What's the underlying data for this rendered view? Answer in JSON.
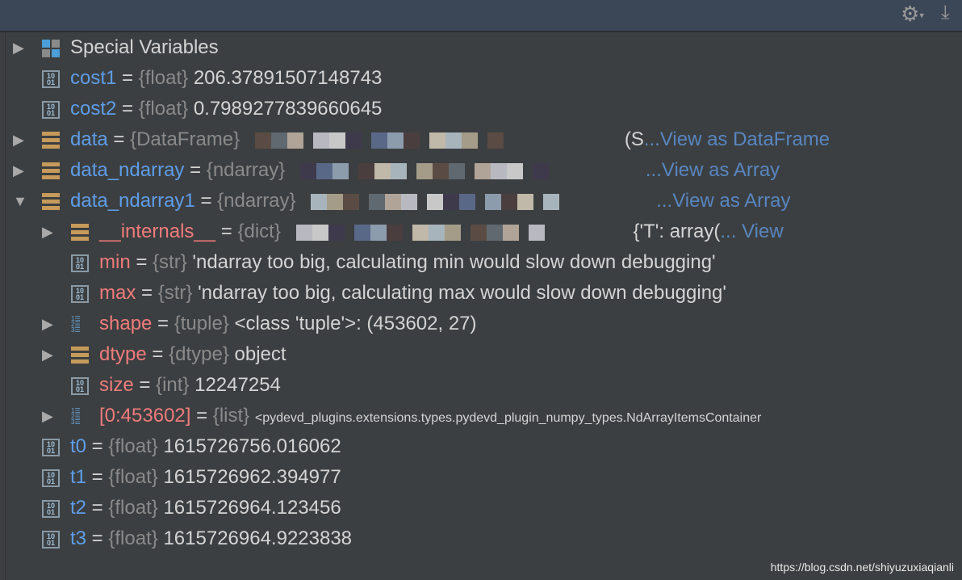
{
  "toolbar": {
    "settings_icon": "gear-icon",
    "download_icon": "download-icon"
  },
  "rows": [
    {
      "indent": 0,
      "expand": "collapsed",
      "icon": "special",
      "name": "Special Variables",
      "name_color": "plain"
    },
    {
      "indent": 0,
      "expand": "none",
      "icon": "num",
      "name": "cost1",
      "type": "{float}",
      "value": "206.37891507148743"
    },
    {
      "indent": 0,
      "expand": "none",
      "icon": "num",
      "name": "cost2",
      "type": "{float}",
      "value": "0.7989277839660645"
    },
    {
      "indent": 0,
      "expand": "collapsed",
      "icon": "stack",
      "name": "data",
      "type": "{DataFrame}",
      "value": "(S",
      "link": "...View as DataFrame"
    },
    {
      "indent": 0,
      "expand": "collapsed",
      "icon": "stack",
      "name": "data_ndarray",
      "type": "{ndarray}",
      "value": "",
      "link": "...View as Array"
    },
    {
      "indent": 0,
      "expand": "expanded",
      "icon": "stack",
      "name": "data_ndarray1",
      "type": "{ndarray}",
      "value": "",
      "link": "...View as Array"
    },
    {
      "indent": 1,
      "expand": "collapsed",
      "icon": "stack",
      "name": "__internals__",
      "type": "{dict}",
      "value": "{'T': array(",
      "link": "... View"
    },
    {
      "indent": 1,
      "expand": "none",
      "icon": "num",
      "name": "min",
      "type": "{str}",
      "value": "'ndarray too big, calculating min would slow down debugging'"
    },
    {
      "indent": 1,
      "expand": "none",
      "icon": "num",
      "name": "max",
      "type": "{str}",
      "value": "'ndarray too big, calculating max would slow down debugging'"
    },
    {
      "indent": 1,
      "expand": "collapsed",
      "icon": "tuple",
      "name": "shape",
      "type": "{tuple}",
      "value": "<class 'tuple'>: (453602, 27)"
    },
    {
      "indent": 1,
      "expand": "collapsed",
      "icon": "stack",
      "name": "dtype",
      "type": "{dtype}",
      "value": "object"
    },
    {
      "indent": 1,
      "expand": "none",
      "icon": "num",
      "name": "size",
      "type": "{int}",
      "value": "12247254"
    },
    {
      "indent": 1,
      "expand": "collapsed",
      "icon": "tuple",
      "name": "[0:453602] ",
      "type": "{list}",
      "value": "<pydevd_plugins.extensions.types.pydevd_plugin_numpy_types.NdArrayItemsContainer"
    },
    {
      "indent": 0,
      "expand": "none",
      "icon": "num",
      "name": "t0",
      "type": "{float}",
      "value": "1615726756.016062"
    },
    {
      "indent": 0,
      "expand": "none",
      "icon": "num",
      "name": "t1",
      "type": "{float}",
      "value": "1615726962.394977"
    },
    {
      "indent": 0,
      "expand": "none",
      "icon": "num",
      "name": "t2",
      "type": "{float}",
      "value": "1615726964.123456"
    },
    {
      "indent": 0,
      "expand": "none",
      "icon": "num",
      "name": "t3",
      "type": "{float}",
      "value": "1615726964.9223838"
    }
  ],
  "watermark": "https://blog.csdn.net/shiyuzuxiaqianli",
  "colors": {
    "background": "#3c3f41",
    "name_top": "#5e9de8",
    "name_child": "#f07b7b",
    "type": "#8a8a8a",
    "link": "#5886c0"
  }
}
